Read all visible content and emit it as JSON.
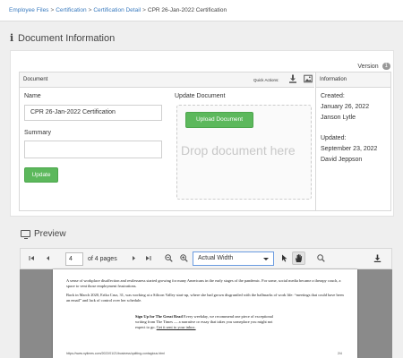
{
  "breadcrumb": {
    "items": [
      "Employee Files",
      "Certification",
      "Certification Detail"
    ],
    "current": "CPR 26-Jan-2022 Certification",
    "separator": ">"
  },
  "document_info": {
    "title": "Document Information",
    "icon": "info-icon",
    "version_label": "Version",
    "version_count": "1"
  },
  "panel": {
    "document_header": "Document",
    "quick_actions_label": "Quick Actions:",
    "quick_action_icons": [
      "download-icon",
      "image-icon"
    ],
    "information_header": "Information"
  },
  "form": {
    "name_label": "Name",
    "name_value": "CPR 26-Jan-2022 Certification",
    "summary_label": "Summary",
    "summary_value": "",
    "update_button": "Update"
  },
  "upload": {
    "label": "Update Document",
    "button": "Upload Document",
    "drop_text": "Drop document here"
  },
  "information": {
    "created_label": "Created:",
    "created_date": "January 26, 2022",
    "created_by": "Janson Lytle",
    "updated_label": "Updated:",
    "updated_date": "September 23, 2022",
    "updated_by": "David Jeppson"
  },
  "preview": {
    "title": "Preview",
    "icon": "monitor-icon",
    "page_number": "4",
    "page_total_text": "of 4 pages",
    "zoom": "Actual Width",
    "toolbar_icons": [
      "first-page-icon",
      "prev-page-icon",
      "next-page-icon",
      "last-page-icon",
      "zoom-out-icon",
      "zoom-in-icon",
      "select-cursor-icon",
      "hand-tool-icon",
      "search-icon",
      "download-icon"
    ]
  },
  "pdf": {
    "para1": "A sense of workplace disaffection and restlessness started growing for many Americans in the early stages of the pandemic. For some, social media became a therapy couch, a space to vent those employment frustrations.",
    "para2": "Back in March 2020, Erika Cruz, 31, was working at a Silicon Valley start-up, where she had grown disgruntled with the hallmarks of work life: “meetings that could have been an email” and lack of control over her schedule.",
    "callout_bold": "Sign Up for The Great Read",
    "callout_text": "Every weekday, we recommend one piece of exceptional writing from The Times — a narrative or essay that takes you someplace you might not expect to go.",
    "callout_link": "Get it sent to your inbox.",
    "footer_url": "https://www.nytimes.com/2022/01/21/business/quitting-contagious.html",
    "footer_page": "2/4"
  },
  "colors": {
    "accent_green": "#5cb85c",
    "link_blue": "#3a7bbf",
    "select_border": "#6a9be0"
  }
}
